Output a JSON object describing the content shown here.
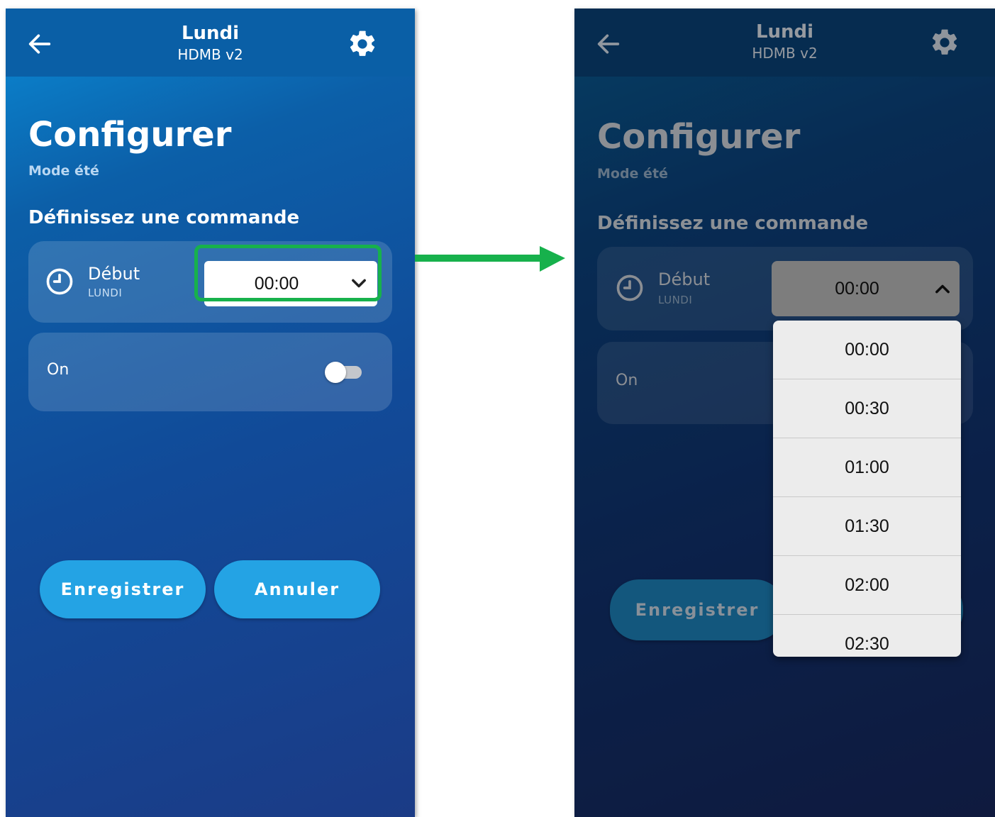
{
  "header": {
    "title": "Lundi",
    "subtitle": "HDMB v2"
  },
  "page": {
    "title": "Configurer",
    "mode": "Mode été",
    "section_title": "Définissez une commande"
  },
  "start_card": {
    "label": "Début",
    "day": "LUNDI",
    "selected_time": "00:00"
  },
  "on_card": {
    "label": "On",
    "toggle_on": false
  },
  "buttons": {
    "save": "Enregistrer",
    "cancel": "Annuler"
  },
  "dropdown": {
    "options": [
      "00:00",
      "00:30",
      "01:00",
      "01:30",
      "02:00",
      "02:30"
    ]
  },
  "colors": {
    "accent": "#24a3e4",
    "highlight": "#17b14c",
    "arrow": "#17b14c"
  },
  "icons": {
    "back": "back-arrow-icon",
    "settings": "gear-icon",
    "clock": "clock-icon",
    "chevron_down": "chevron-down-icon",
    "chevron_up": "chevron-up-icon"
  }
}
